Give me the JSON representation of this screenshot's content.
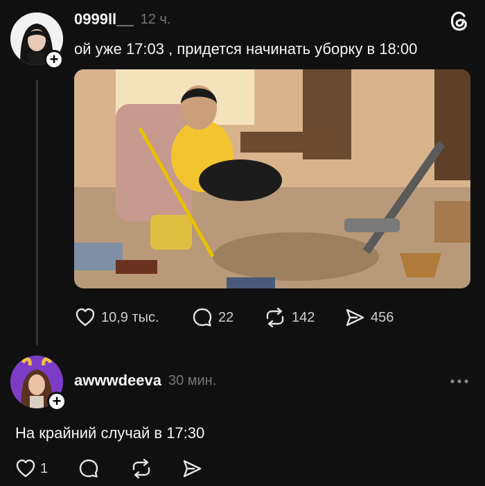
{
  "post": {
    "username": "0999ll__",
    "time": "12 ч.",
    "text": "ой уже 17:03 , придется начинать уборку в 18:00",
    "actions": {
      "likes": "10,9 тыс.",
      "comments": "22",
      "reposts": "142",
      "shares": "456"
    }
  },
  "reply": {
    "username": "awwwdeeva",
    "time": "30 мин.",
    "text": "На крайний случай в 17:30",
    "actions": {
      "likes": "1"
    }
  },
  "colors": {
    "background": "#101010",
    "text": "#f3f5f7",
    "muted": "#777777"
  },
  "icons": [
    "threads-logo-icon",
    "heart-icon",
    "comment-icon",
    "repost-icon",
    "share-icon",
    "more-icon",
    "plus-icon"
  ]
}
